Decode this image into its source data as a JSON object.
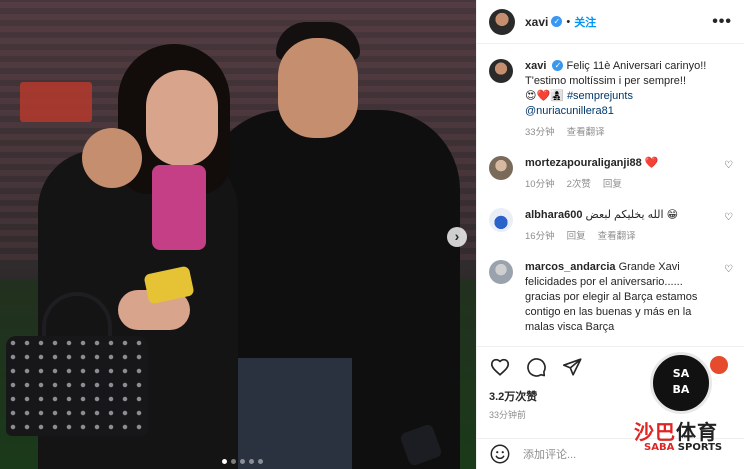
{
  "post": {
    "username": "xavi",
    "verified_mark": "✓",
    "separator": "•",
    "follow_label": "关注",
    "more_label": "•••"
  },
  "photo": {
    "carousel_total": 5,
    "carousel_active": 1,
    "next_label": "›"
  },
  "caption": {
    "username": "xavi",
    "text": "Feliç 11è Aniversari carinyo!! T'estimo moltíssim i per sempre!!",
    "emojis": "😍❤️👩‍👧‍👦",
    "hashtag": "#semprejunts",
    "mention": "@nuriacunillera81",
    "time": "33分钟",
    "translate": "查看翻译"
  },
  "comments": [
    {
      "username": "mortezapouraliganji88",
      "text": "❤️",
      "time": "10分钟",
      "likes": "2次赞",
      "reply": "回复"
    },
    {
      "username": "albhara600",
      "text": "الله يخليكم لبعض 😁",
      "time": "16分钟",
      "reply": "回复",
      "translate": "查看翻译"
    },
    {
      "username": "marcos_andarcia",
      "text": "Grande Xavi felicidades por el aniversario...... gracias por elegir al Barça estamos contigo en las buenas y más en la malas visca Barça",
      "time": "",
      "reply": ""
    }
  ],
  "stats": {
    "likes": "3.2万次赞",
    "posted": "33分钟前"
  },
  "add_comment": {
    "placeholder": "添加评论..."
  },
  "watermark": {
    "ball_top": "SA",
    "ball_bottom": "BA",
    "cn_red": "沙巴",
    "cn_black": "体育",
    "en_red": "SABA",
    "en_black": "SPORTS"
  },
  "icons": {
    "heart": "heart-icon",
    "comment": "comment-icon",
    "share": "share-icon",
    "save": "bookmark-icon",
    "emoji": "emoji-icon"
  }
}
